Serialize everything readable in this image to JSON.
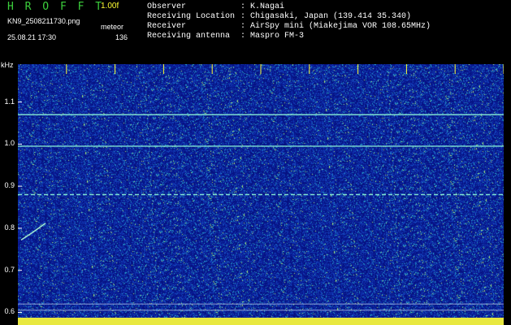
{
  "header": {
    "app_title": "H R O F F T",
    "version": "1.00f",
    "filename": "KN9_2508211730.png",
    "meteor_label": "meteor",
    "meteor_count": "136",
    "datetime": "25.08.21 17:30"
  },
  "info": {
    "observer_label": "Observer",
    "observer_value": ": K.Nagai",
    "location_label": "Receiving Location",
    "location_value": ": Chigasaki, Japan (139.414 35.340)",
    "receiver_label": "Receiver",
    "receiver_value": ": AirSpy mini (Miakejima VOR 108.65MHz)",
    "antenna_label": "Receiving antenna",
    "antenna_value": ": Maspro FM-3"
  },
  "colors": {
    "background": "#000000",
    "spectrogram_bg": "#0a148f",
    "title_green": "#3ccf3c",
    "version_yellow": "#ffff33",
    "signal_line": "#7fe0d0",
    "bottom_strip": "#e8e840"
  },
  "chart_data": {
    "type": "heatmap",
    "ylabel": "kHz",
    "yticks": [
      "1.1",
      "1.0",
      "0.9",
      "0.8",
      "0.7",
      "0.6"
    ],
    "ytick_values": [
      1.1,
      1.0,
      0.9,
      0.8,
      0.7,
      0.6
    ],
    "ylim": [
      0.57,
      1.19
    ],
    "xticks": [
      "1731",
      "1732",
      "1733",
      "1734",
      "1735",
      "1736",
      "1737",
      "1738",
      "1739",
      "1740"
    ],
    "xlim": [
      1730,
      1740
    ],
    "signals": [
      {
        "y": 1.07
      },
      {
        "y": 0.995
      },
      {
        "y": 0.88
      },
      {
        "y": 0.62
      },
      {
        "y": 0.605
      }
    ]
  }
}
